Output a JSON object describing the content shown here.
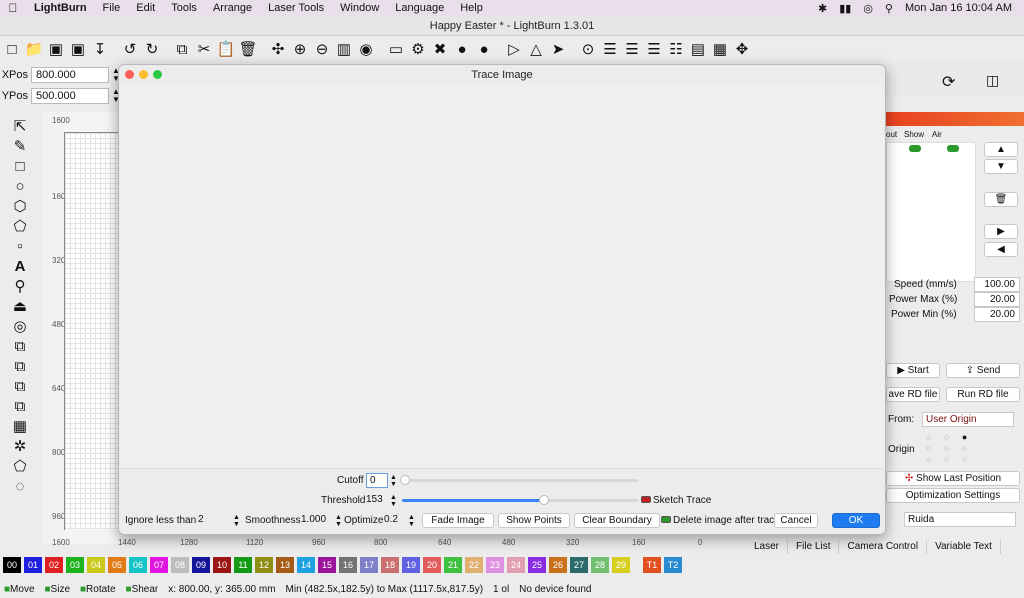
{
  "menubar": {
    "app": "LightBurn",
    "items": [
      "File",
      "Edit",
      "Tools",
      "Arrange",
      "Laser Tools",
      "Window",
      "Language",
      "Help"
    ],
    "clock": "Mon Jan 16  10:04 AM"
  },
  "window_title": "Happy Easter  * - LightBurn 1.3.01",
  "position": {
    "xpos_label": "XPos",
    "xpos_value": "800.000",
    "ypos_label": "YPos",
    "ypos_value": "500.000",
    "unit": "mm"
  },
  "ruler": {
    "v_labels": [
      "1600",
      "160",
      "320",
      "480",
      "640",
      "800",
      "960"
    ],
    "h_labels": [
      "1600",
      "1440",
      "1280",
      "1120",
      "960",
      "800",
      "640",
      "480",
      "320",
      "160",
      "0"
    ]
  },
  "dialog": {
    "title": "Trace Image",
    "cutoff_label": "Cutoff",
    "cutoff_value": "0",
    "threshold_label": "Threshold",
    "threshold_value": "153",
    "threshold_fraction": 0.6,
    "sketch_label": "Sketch Trace",
    "ignore_label": "Ignore less than",
    "ignore_value": "2",
    "smooth_label": "Smoothness",
    "smooth_value": "1.000",
    "optimize_label": "Optimize",
    "optimize_value": "0.2",
    "fade_button": "Fade Image",
    "points_button": "Show Points",
    "boundary_button": "Clear Boundary",
    "delete_label": "Delete image after trac",
    "cancel_button": "Cancel",
    "ok_button": "OK"
  },
  "right_panel": {
    "col_out": "out",
    "col_show": "Show",
    "col_air": "Air",
    "speed_label": "Speed (mm/s)",
    "speed_value": "100.00",
    "pmax_label": "Power Max (%)",
    "pmax_value": "20.00",
    "pmin_label": "Power Min (%)",
    "pmin_value": "20.00",
    "start": "Start",
    "send": "Send",
    "save_rd": "ave RD file",
    "run_rd": "Run RD file",
    "from_label": "From:",
    "from_value": "User Origin",
    "origin_label": "Origin",
    "show_last": "Show Last Position",
    "opt_settings": "Optimization Settings",
    "device": "Ruida"
  },
  "bottom_tabs": [
    "Laser",
    "File List",
    "Camera Control",
    "Variable Text"
  ],
  "palette": [
    {
      "label": "00",
      "color": "#000000"
    },
    {
      "label": "01",
      "color": "#1f1fe0"
    },
    {
      "label": "02",
      "color": "#e02020"
    },
    {
      "label": "03",
      "color": "#1db31d"
    },
    {
      "label": "04",
      "color": "#c9c91a"
    },
    {
      "label": "05",
      "color": "#e07b17"
    },
    {
      "label": "06",
      "color": "#15c5c5"
    },
    {
      "label": "07",
      "color": "#e015e0"
    },
    {
      "label": "08",
      "color": "#bdbdbd"
    },
    {
      "label": "09",
      "color": "#15159a"
    },
    {
      "label": "10",
      "color": "#9a1515"
    },
    {
      "label": "11",
      "color": "#159a15"
    },
    {
      "label": "12",
      "color": "#8f8f15"
    },
    {
      "label": "13",
      "color": "#a35b15"
    },
    {
      "label": "14",
      "color": "#1fa0e0"
    },
    {
      "label": "15",
      "color": "#9a159a"
    },
    {
      "label": "16",
      "color": "#737373"
    },
    {
      "label": "17",
      "color": "#8080c8"
    },
    {
      "label": "18",
      "color": "#c87070"
    },
    {
      "label": "19",
      "color": "#6060e0"
    },
    {
      "label": "20",
      "color": "#e05b5b"
    },
    {
      "label": "21",
      "color": "#40c040"
    },
    {
      "label": "22",
      "color": "#e0b070"
    },
    {
      "label": "23",
      "color": "#e090e0"
    },
    {
      "label": "24",
      "color": "#e0a0b0"
    },
    {
      "label": "25",
      "color": "#8a2be2"
    },
    {
      "label": "26",
      "color": "#c8701a"
    },
    {
      "label": "27",
      "color": "#2a6a6a"
    },
    {
      "label": "28",
      "color": "#70c070"
    },
    {
      "label": "29",
      "color": "#d8d020"
    },
    {
      "label": "T1",
      "color": "#e05020"
    },
    {
      "label": "T2",
      "color": "#2a8ad0"
    }
  ],
  "statusbar": {
    "move": "Move",
    "size": "Size",
    "rotate": "Rotate",
    "shear": "Shear",
    "coords": "x: 800.00, y: 365.00 mm",
    "bounds": "Min (482.5x,182.5y) to Max (1117.5x,817.5y)",
    "objects": "1 ol",
    "device": "No device found"
  }
}
